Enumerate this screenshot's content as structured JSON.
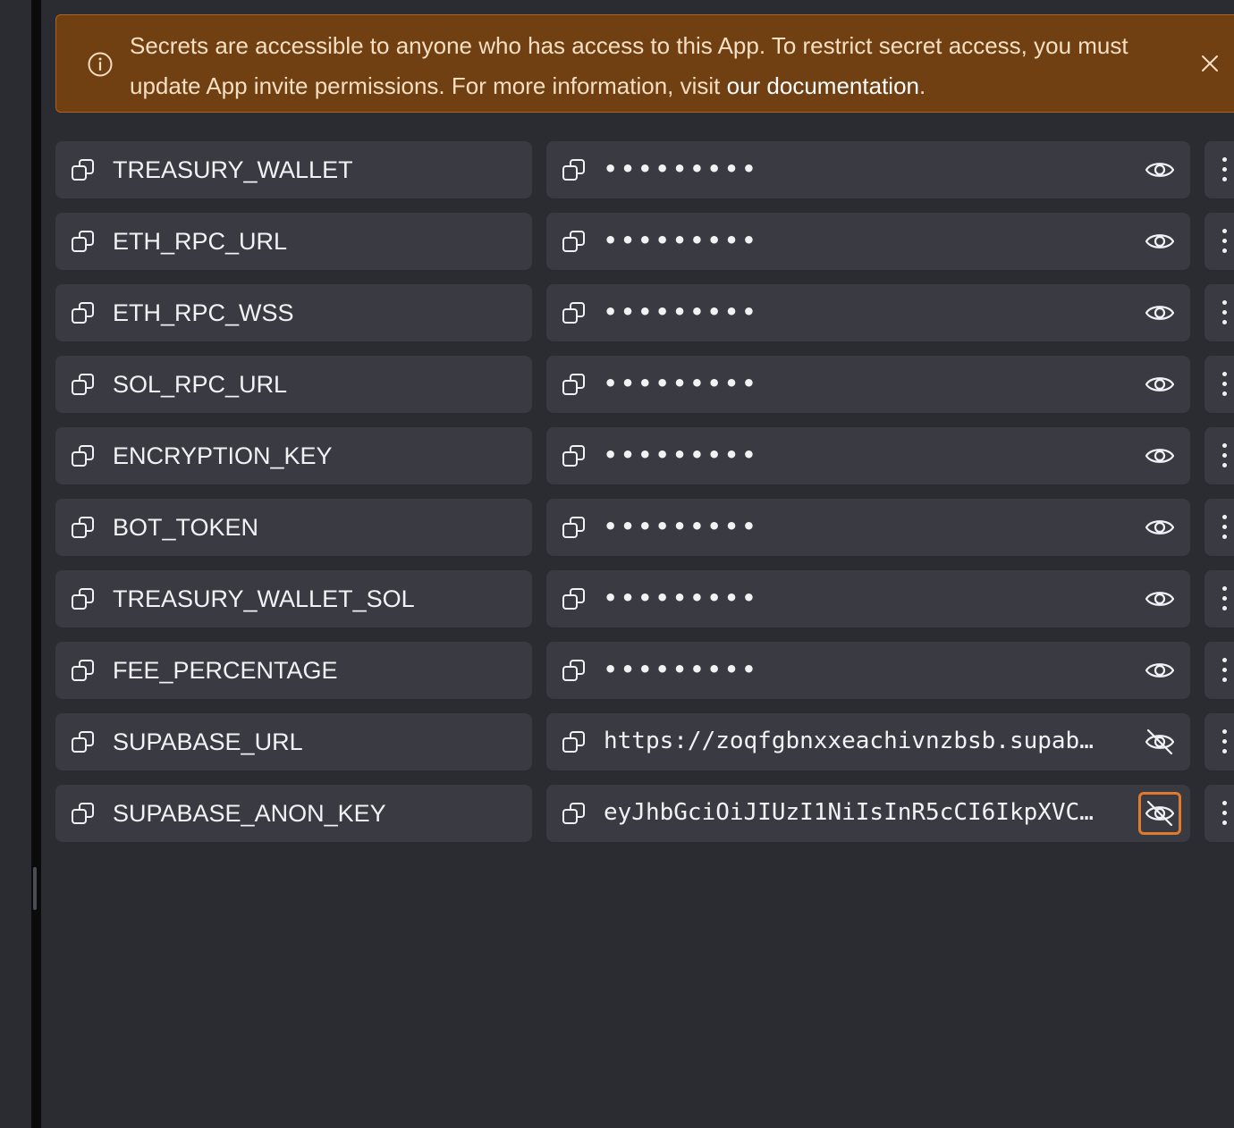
{
  "banner": {
    "text": "Secrets are accessible to anyone who has access to this App. To restrict secret access, you must update App invite permissions. For more information, visit ",
    "link_text": "our documentation",
    "suffix": "."
  },
  "secrets": [
    {
      "key": "TREASURY_WALLET",
      "value": "•••••••••",
      "revealed": false
    },
    {
      "key": "ETH_RPC_URL",
      "value": "•••••••••",
      "revealed": false
    },
    {
      "key": "ETH_RPC_WSS",
      "value": "•••••••••",
      "revealed": false
    },
    {
      "key": "SOL_RPC_URL",
      "value": "•••••••••",
      "revealed": false
    },
    {
      "key": "ENCRYPTION_KEY",
      "value": "•••••••••",
      "revealed": false
    },
    {
      "key": "BOT_TOKEN",
      "value": "•••••••••",
      "revealed": false
    },
    {
      "key": "TREASURY_WALLET_SOL",
      "value": "•••••••••",
      "revealed": false
    },
    {
      "key": "FEE_PERCENTAGE",
      "value": "•••••••••",
      "revealed": false
    },
    {
      "key": "SUPABASE_URL",
      "value": "https://zoqfgbnxxeachivnzbsb.supab…",
      "revealed": true
    },
    {
      "key": "SUPABASE_ANON_KEY",
      "value": "eyJhbGciOiJIUzI1NiIsInR5cCI6IkpXVC…",
      "revealed": true,
      "focused": true
    }
  ],
  "colors": {
    "banner_bg": "#703f12",
    "banner_border": "#b0631c",
    "row_bg": "#3a3b42",
    "focus_ring": "#e07a2e"
  }
}
